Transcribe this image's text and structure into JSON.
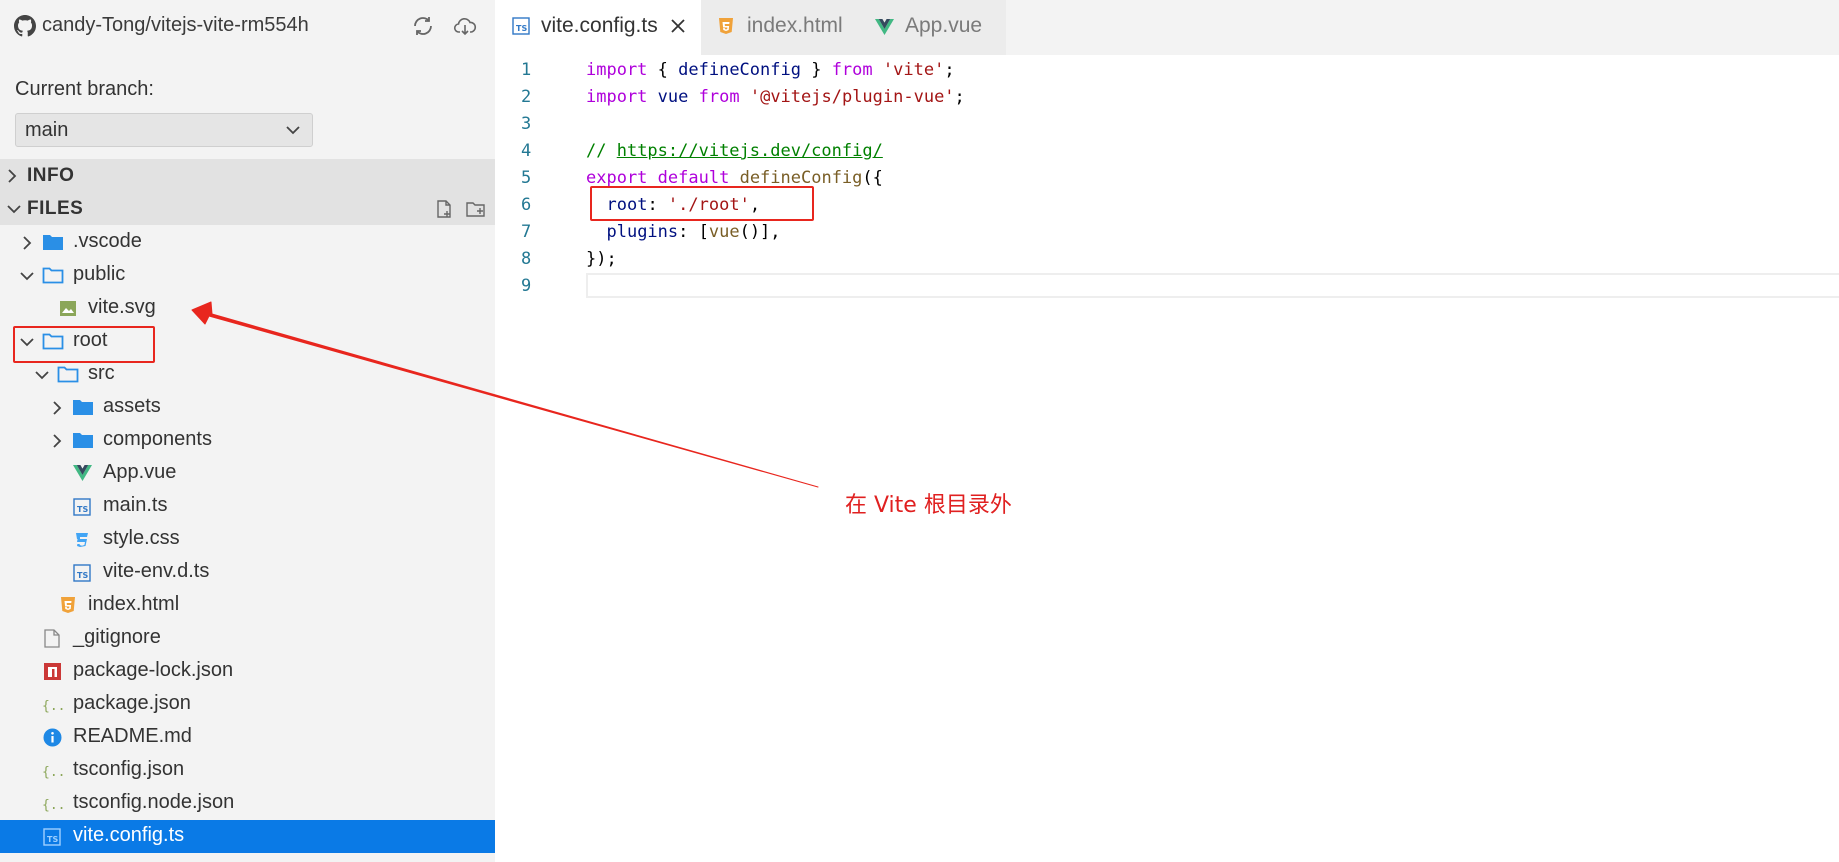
{
  "sidebar": {
    "repo": "candy-Tong/vitejs-vite-rm554h",
    "branch_label": "Current branch:",
    "branch_value": "main",
    "sections": {
      "info": "INFO",
      "files": "FILES"
    },
    "files": [
      {
        "label": ".vscode"
      },
      {
        "label": "public"
      },
      {
        "label": "vite.svg"
      },
      {
        "label": "root"
      },
      {
        "label": "src"
      },
      {
        "label": "assets"
      },
      {
        "label": "components"
      },
      {
        "label": "App.vue"
      },
      {
        "label": "main.ts"
      },
      {
        "label": "style.css"
      },
      {
        "label": "vite-env.d.ts"
      },
      {
        "label": "index.html"
      },
      {
        "label": "_gitignore"
      },
      {
        "label": "package-lock.json"
      },
      {
        "label": "package.json"
      },
      {
        "label": "README.md"
      },
      {
        "label": "tsconfig.json"
      },
      {
        "label": "tsconfig.node.json"
      },
      {
        "label": "vite.config.ts"
      }
    ]
  },
  "tabs": [
    {
      "label": "vite.config.ts"
    },
    {
      "label": "index.html"
    },
    {
      "label": "App.vue"
    }
  ],
  "code": {
    "line_numbers": [
      "1",
      "2",
      "3",
      "4",
      "5",
      "6",
      "7",
      "8",
      "9"
    ],
    "tokens": {
      "l1": [
        "import",
        " { ",
        "defineConfig",
        " } ",
        "from",
        " ",
        "'vite'",
        ";"
      ],
      "l2": [
        "import",
        " ",
        "vue",
        " ",
        "from",
        " ",
        "'@vitejs/plugin-vue'",
        ";"
      ],
      "l4": [
        "// ",
        "https://vitejs.dev/config/"
      ],
      "l5": [
        "export",
        " ",
        "default",
        " ",
        "defineConfig",
        "({"
      ],
      "l6": [
        "  ",
        "root",
        ": ",
        "'./root'",
        ","
      ],
      "l7": [
        "  ",
        "plugins",
        ": [",
        "vue",
        "()],"
      ],
      "l8": [
        "});"
      ]
    }
  },
  "annotation": {
    "text": "在 Vite 根目录外"
  },
  "colors": {
    "selected": "#0a7ae6",
    "annotation": "#e8261e",
    "folder": "#2a8fe6",
    "keyword": "#af00db",
    "string": "#a31515"
  }
}
